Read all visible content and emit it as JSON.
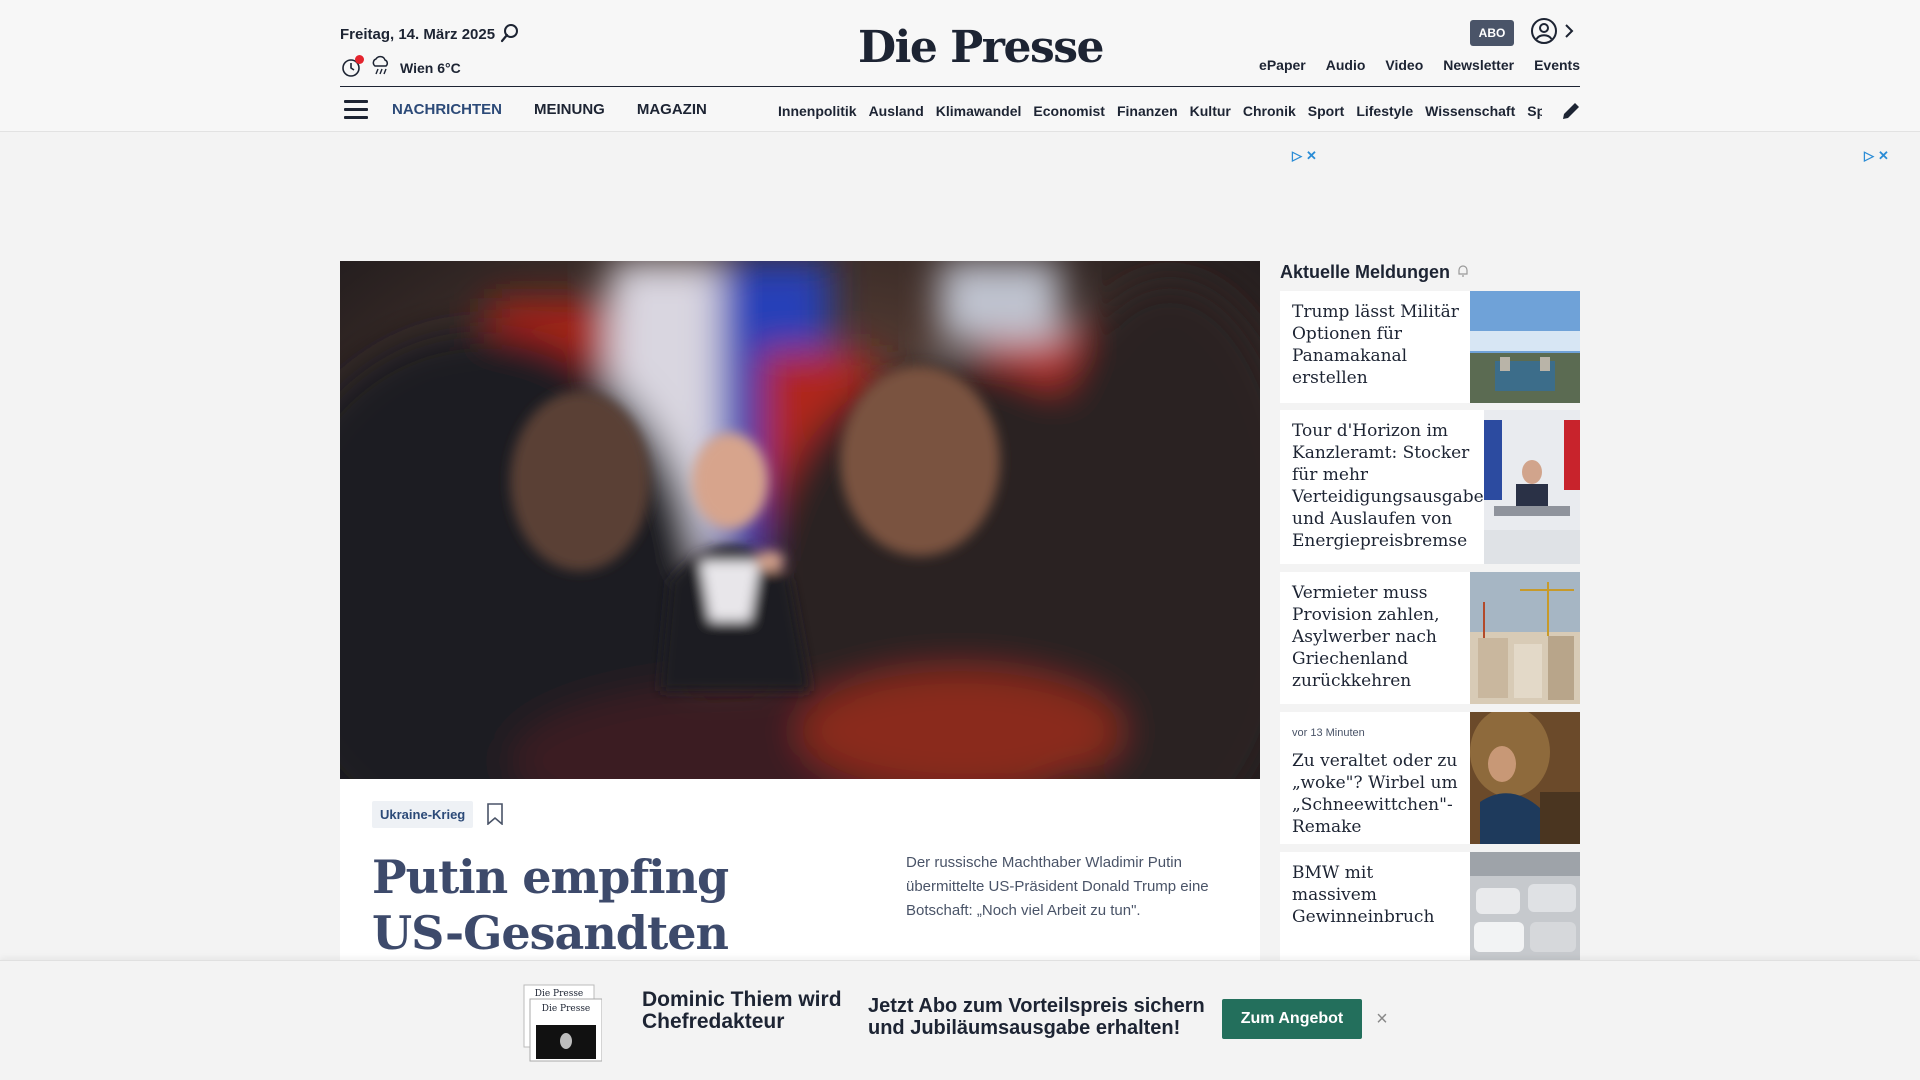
{
  "header": {
    "date": "Freitag, 14. März 2025",
    "weather": "Wien 6°C",
    "logo": "Die Presse",
    "abo": "ABO",
    "topnav": [
      "ePaper",
      "Audio",
      "Video",
      "Newsletter",
      "Events"
    ],
    "mainnav": [
      "NACHRICHTEN",
      "MEINUNG",
      "MAGAZIN"
    ],
    "subnav": [
      "Innenpolitik",
      "Ausland",
      "Klimawandel",
      "Economist",
      "Finanzen",
      "Kultur",
      "Chronik",
      "Sport",
      "Lifestyle",
      "Wissenschaft",
      "Spectrum"
    ]
  },
  "hero": {
    "tag": "Ukraine-Krieg",
    "headline": "Putin empfing US-Gesandten Witkoff:",
    "teaser": "Der russische Machthaber Wladimir Putin übermittelte US-Präsident Donald Trump eine Botschaft: „Noch viel Arbeit zu tun\"."
  },
  "sidebar": {
    "title": "Aktuelle Meldungen",
    "items": [
      {
        "text": "Trump lässt Militär Optionen für Panamakanal erstellen",
        "timestamp": ""
      },
      {
        "text": "Tour d'Horizon im Kanzleramt: Stocker für mehr Verteidigungsausgaben und Auslaufen von Energiepreisbremse",
        "timestamp": ""
      },
      {
        "text": "Vermieter muss Provision zahlen, Asylwerber nach Griechenland zurückkehren",
        "timestamp": ""
      },
      {
        "text": "Zu veraltet oder zu „woke\"? Wirbel um „Schneewittchen\"-Remake",
        "timestamp": "vor 13 Minuten"
      },
      {
        "text": "BMW mit massivem Gewinneinbruch",
        "timestamp": ""
      }
    ]
  },
  "banner": {
    "title": "Dominic Thiem wird Chefredakteur",
    "text": "Jetzt Abo zum Vorteilspreis sichern und Jubiläumsausgabe erhalten!",
    "cta": "Zum Angebot",
    "papers_logo": "Die Presse"
  },
  "colors": {
    "brand_dark": "#1d2433",
    "nav_blue": "#2c4a78",
    "cta_green": "#236f5c",
    "alert_red": "#e4242e"
  }
}
